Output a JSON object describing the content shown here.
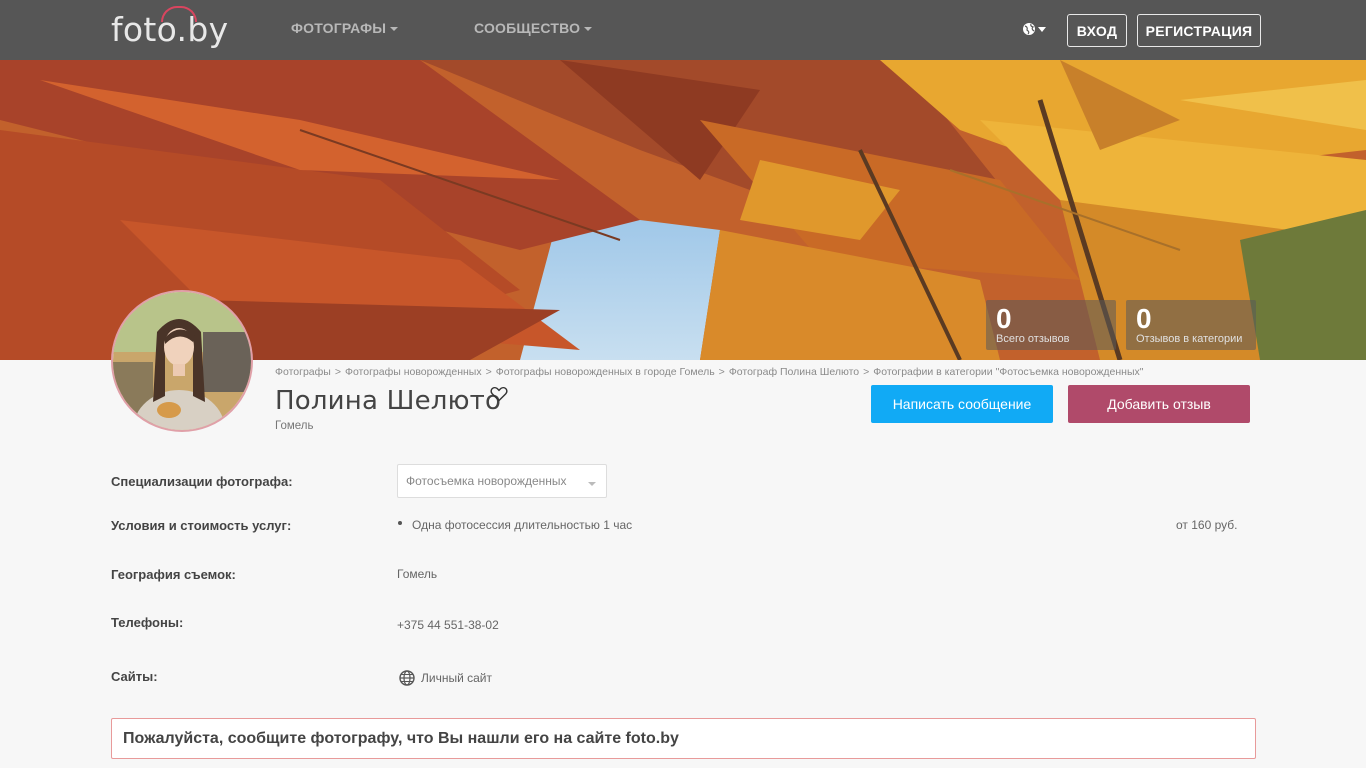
{
  "header": {
    "logo": "foto.by",
    "nav": [
      {
        "label": "ФОТОГРАФЫ"
      },
      {
        "label": "СООБЩЕСТВО"
      }
    ],
    "login_label": "ВХОД",
    "register_label": "РЕГИСТРАЦИЯ"
  },
  "banner": {
    "stats": [
      {
        "value": "0",
        "label": "Всего отзывов"
      },
      {
        "value": "0",
        "label": "Отзывов в категории"
      }
    ]
  },
  "profile": {
    "breadcrumbs": [
      "Фотографы",
      "Фотографы новорожденных",
      "Фотографы новорожденных в городе Гомель",
      "Фотограф Полина Шелюто",
      "Фотографии в категории \"Фотосъемка новорожденных\""
    ],
    "name": "Полина Шелюто",
    "city": "Гомель",
    "message_button": "Написать сообщение",
    "review_button": "Добавить отзыв"
  },
  "details": {
    "specializations_label": "Специализации фотографа:",
    "specialization_selected": "Фотосъемка новорожденных",
    "services_label": "Условия и стоимость услуг:",
    "service_item": "Одна фотосессия длительностью 1 час",
    "service_price": "от 160 руб.",
    "geography_label": "География съемок:",
    "geography_value": "Гомель",
    "phones_label": "Телефоны:",
    "phone_value": "+375 44 551-38-02",
    "sites_label": "Сайты:",
    "site_link": "Личный сайт"
  },
  "notice": "Пожалуйста, сообщите фотографу, что Вы нашли его на сайте foto.by"
}
